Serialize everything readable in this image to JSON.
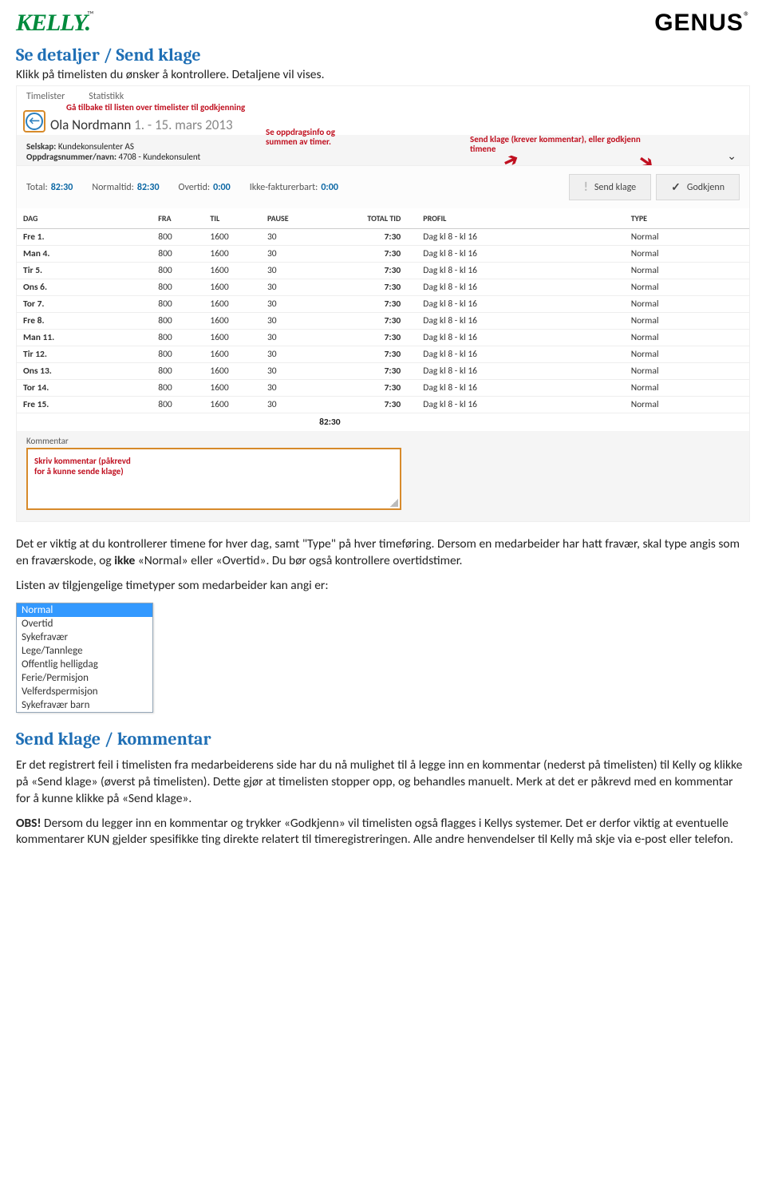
{
  "logos": {
    "kelly": "KELLY",
    "genus": "GENUS"
  },
  "section1": {
    "title": "Se detaljer / Send klage",
    "intro": "Klikk på timelisten du ønsker å kontrollere. Detaljene vil vises."
  },
  "screenshot": {
    "tabs": [
      "Timelister",
      "Statistikk"
    ],
    "back_annot": "Gå tilbake til listen over timelister til godkjenning",
    "title_name": "Ola Nordmann",
    "title_date": "1. - 15. mars 2013",
    "company_label": "Selskap:",
    "company_value": "Kundekonsulenter AS",
    "assignment_label": "Oppdragsnummer/navn:",
    "assignment_value": "4708 - Kundekonsulent",
    "mid_annot_1": "Se oppdragsinfo og",
    "mid_annot_2": "summen av timer.",
    "right_annot_1": "Send klage (krever kommentar), eller godkjenn",
    "right_annot_2": "timene",
    "summary": {
      "total_label": "Total:",
      "total_val": "82:30",
      "normal_label": "Normaltid:",
      "normal_val": "82:30",
      "over_label": "Overtid:",
      "over_val": "0:00",
      "nonbill_label": "Ikke-fakturerbart:",
      "nonbill_val": "0:00"
    },
    "buttons": {
      "send_klage": "Send klage",
      "godkjenn": "Godkjenn"
    },
    "headers": {
      "dag": "DAG",
      "fra": "FRA",
      "til": "TIL",
      "pause": "PAUSE",
      "total": "TOTAL TID",
      "profil": "PROFIL",
      "type": "TYPE"
    },
    "rows": [
      {
        "dag": "Fre 1.",
        "fra": "800",
        "til": "1600",
        "pause": "30",
        "total": "7:30",
        "profil": "Dag kl 8 - kl 16",
        "type": "Normal"
      },
      {
        "dag": "Man 4.",
        "fra": "800",
        "til": "1600",
        "pause": "30",
        "total": "7:30",
        "profil": "Dag kl 8 - kl 16",
        "type": "Normal"
      },
      {
        "dag": "Tir 5.",
        "fra": "800",
        "til": "1600",
        "pause": "30",
        "total": "7:30",
        "profil": "Dag kl 8 - kl 16",
        "type": "Normal"
      },
      {
        "dag": "Ons 6.",
        "fra": "800",
        "til": "1600",
        "pause": "30",
        "total": "7:30",
        "profil": "Dag kl 8 - kl 16",
        "type": "Normal"
      },
      {
        "dag": "Tor 7.",
        "fra": "800",
        "til": "1600",
        "pause": "30",
        "total": "7:30",
        "profil": "Dag kl 8 - kl 16",
        "type": "Normal"
      },
      {
        "dag": "Fre 8.",
        "fra": "800",
        "til": "1600",
        "pause": "30",
        "total": "7:30",
        "profil": "Dag kl 8 - kl 16",
        "type": "Normal"
      },
      {
        "dag": "Man 11.",
        "fra": "800",
        "til": "1600",
        "pause": "30",
        "total": "7:30",
        "profil": "Dag kl 8 - kl 16",
        "type": "Normal"
      },
      {
        "dag": "Tir 12.",
        "fra": "800",
        "til": "1600",
        "pause": "30",
        "total": "7:30",
        "profil": "Dag kl 8 - kl 16",
        "type": "Normal"
      },
      {
        "dag": "Ons 13.",
        "fra": "800",
        "til": "1600",
        "pause": "30",
        "total": "7:30",
        "profil": "Dag kl 8 - kl 16",
        "type": "Normal"
      },
      {
        "dag": "Tor 14.",
        "fra": "800",
        "til": "1600",
        "pause": "30",
        "total": "7:30",
        "profil": "Dag kl 8 - kl 16",
        "type": "Normal"
      },
      {
        "dag": "Fre 15.",
        "fra": "800",
        "til": "1600",
        "pause": "30",
        "total": "7:30",
        "profil": "Dag kl 8 - kl 16",
        "type": "Normal"
      }
    ],
    "footer_total": "82:30",
    "comment_label": "Kommentar",
    "comment_annot_1": "Skriv kommentar (påkrevd",
    "comment_annot_2": "for å kunne sende klage)"
  },
  "para1": "Det er viktig at du kontrollerer timene for hver dag, samt \"Type\" på hver timeføring. Dersom en medarbeider har hatt fravær, skal type angis som en fraværskode, og ",
  "para1_bold": "ikke",
  "para1_after": " «Normal» eller «Overtid». Du bør også kontrollere overtidstimer.",
  "para2": "Listen av tilgjengelige timetyper som medarbeider kan angi er:",
  "dropdown": {
    "items": [
      "Normal",
      "Overtid",
      "Sykefravær",
      "Lege/Tannlege",
      "Offentlig helligdag",
      "Ferie/Permisjon",
      "Velferdspermisjon",
      "Sykefravær barn"
    ],
    "selected": 0
  },
  "section2": {
    "title": "Send klage / kommentar",
    "body": "Er det registrert feil i timelisten fra medarbeiderens side har du nå mulighet til å legge inn en kommentar (nederst på timelisten) til Kelly og klikke på «Send klage» (øverst på timelisten). Dette gjør at timelisten stopper opp, og behandles manuelt. Merk at det er påkrevd med en kommentar for å kunne klikke på «Send klage»."
  },
  "para3_bold": "OBS!",
  "para3_rest": " Dersom du legger inn en kommentar og trykker «Godkjenn» vil timelisten også flagges i Kellys systemer. Det er derfor viktig at eventuelle kommentarer KUN gjelder spesifikke ting direkte relatert til timeregistreringen. Alle andre henvendelser til Kelly må skje via e-post eller telefon."
}
